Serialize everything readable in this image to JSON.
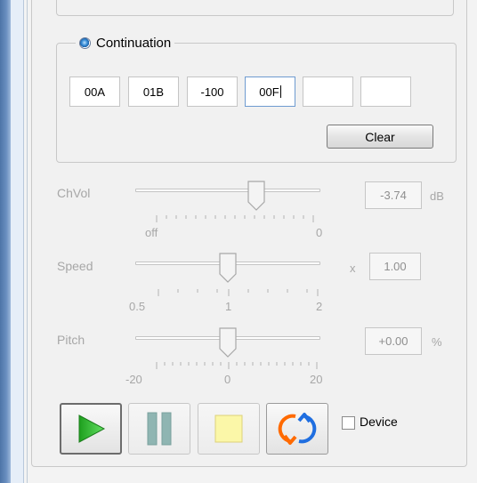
{
  "continuation": {
    "label": "Continuation",
    "fields": [
      "00A",
      "01B",
      "-100",
      "00F",
      "",
      ""
    ],
    "clear_label": "Clear"
  },
  "chvol": {
    "label": "ChVol",
    "value": "-3.74",
    "unit": "dB",
    "tick_min": "off",
    "tick_max": "0",
    "slider_fraction": 0.73
  },
  "speed": {
    "label": "Speed",
    "prefix": "x",
    "value": "1.00",
    "tick_min": "0.5",
    "tick_mid": "1",
    "tick_max": "2",
    "slider_fraction": 0.5
  },
  "pitch": {
    "label": "Pitch",
    "value": "+0.00",
    "unit": "%",
    "tick_min": "-20",
    "tick_mid": "0",
    "tick_max": "20",
    "slider_fraction": 0.5
  },
  "transport": {
    "play_icon": "play-icon",
    "pause_icon": "pause-icon",
    "stop_icon": "stop-icon",
    "loop_icon": "loop-icon",
    "device_label": "Device",
    "device_checked": false
  },
  "colors": {
    "accent_blue": "#3a8fd8",
    "play_green": "#3cc43c",
    "disabled_text": "#a7a7a7"
  }
}
